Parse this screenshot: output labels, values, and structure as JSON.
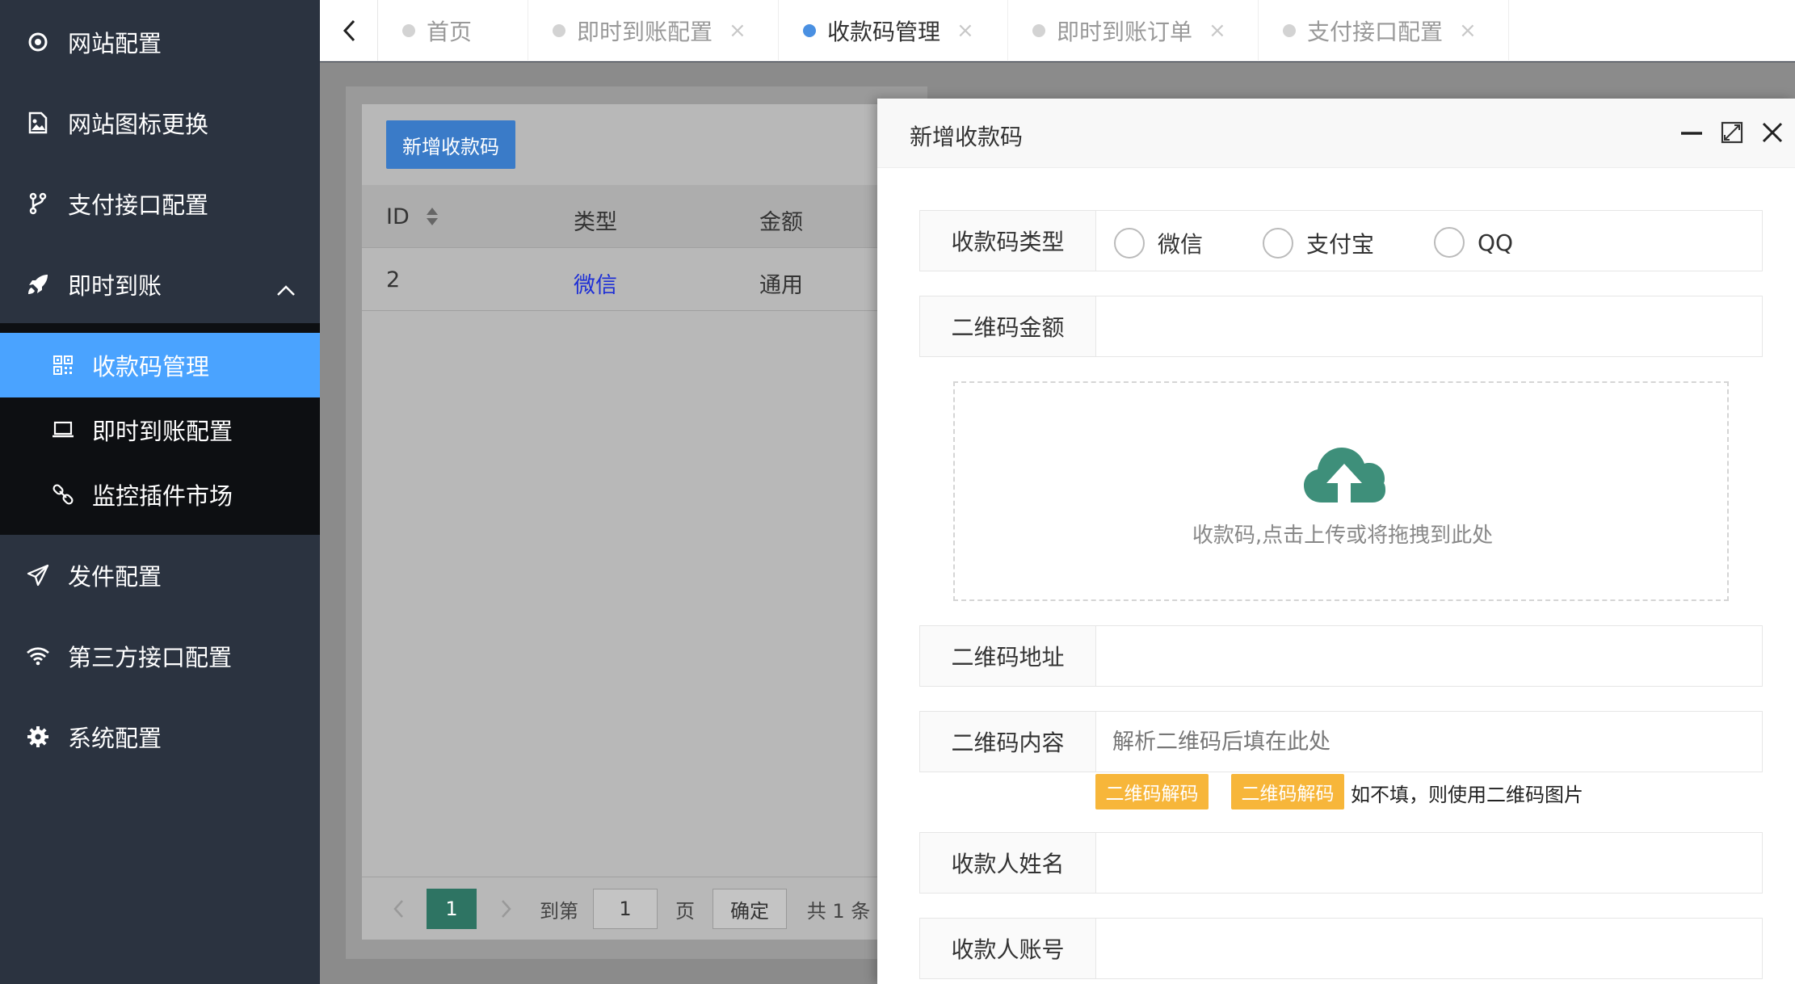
{
  "sidebar": {
    "items": [
      {
        "label": "网站配置",
        "icon": "target-icon"
      },
      {
        "label": "网站图标更换",
        "icon": "image-icon"
      },
      {
        "label": "支付接口配置",
        "icon": "branch-icon"
      },
      {
        "label": "即时到账",
        "icon": "rocket-icon"
      },
      {
        "label": "发件配置",
        "icon": "send-icon"
      },
      {
        "label": "第三方接口配置",
        "icon": "wifi-icon"
      },
      {
        "label": "系统配置",
        "icon": "gear-icon"
      }
    ],
    "submenu": [
      {
        "label": "收款码管理",
        "icon": "qrcode-icon",
        "active": true
      },
      {
        "label": "即时到账配置",
        "icon": "laptop-icon"
      },
      {
        "label": "监控插件市场",
        "icon": "link-icon"
      }
    ]
  },
  "tabs": [
    {
      "label": "首页",
      "closable": false
    },
    {
      "label": "即时到账配置",
      "closable": true
    },
    {
      "label": "收款码管理",
      "closable": true,
      "active": true
    },
    {
      "label": "即时到账订单",
      "closable": true
    },
    {
      "label": "支付接口配置",
      "closable": true
    }
  ],
  "tab_close": "×",
  "list": {
    "add_button": "新增收款码",
    "columns": [
      "ID",
      "类型",
      "金额"
    ],
    "rows": [
      {
        "id": "2",
        "type": "微信",
        "amount": "通用"
      }
    ],
    "pager": {
      "current": "1",
      "goto_label": "到第",
      "goto_value": "1",
      "page_label": "页",
      "confirm": "确定",
      "total": "共 1 条"
    }
  },
  "modal": {
    "title": "新增收款码",
    "type_label": "收款码类型",
    "type_options": [
      "微信",
      "支付宝",
      "QQ"
    ],
    "amount_label": "二维码金额",
    "upload_text": "收款码,点击上传或将拖拽到此处",
    "url_label": "二维码地址",
    "content_label": "二维码内容",
    "content_placeholder": "解析二维码后填在此处",
    "decode_btn_1": "二维码解码",
    "decode_btn_2": "二维码解码",
    "decode_tip": "如不填，则使用二维码图片",
    "payee_name_label": "收款人姓名",
    "payee_account_label": "收款人账号"
  },
  "colors": {
    "sidebar_bg": "#2b3340",
    "active_blue": "#4aa3ff",
    "upload_green": "#3e8f7a",
    "decode_orange": "#f7b63a"
  }
}
